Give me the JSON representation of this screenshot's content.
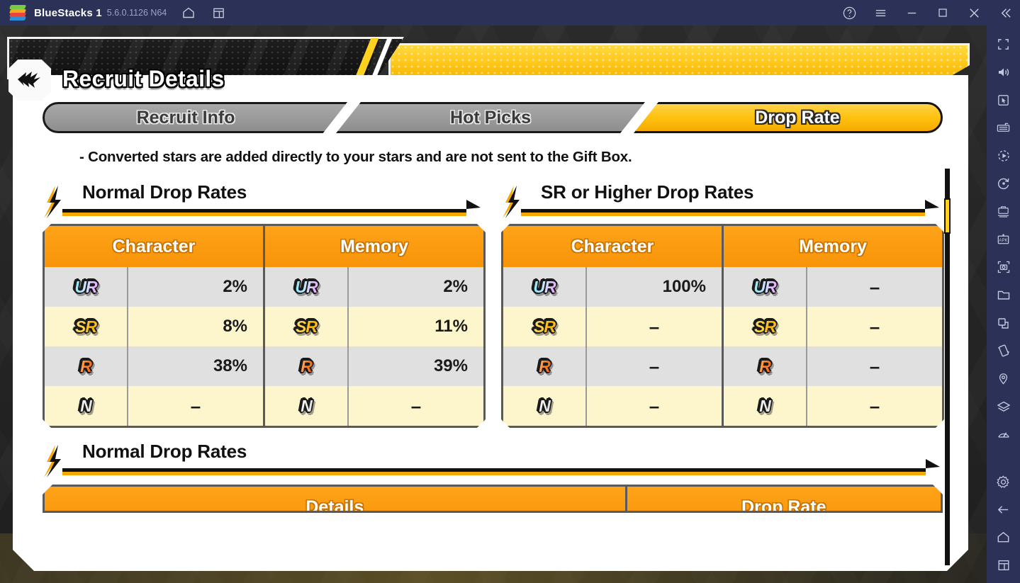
{
  "titlebar": {
    "app_name": "BlueStacks 1",
    "version": "5.6.0.1126 N64",
    "icons": [
      {
        "name": "home-icon",
        "glyph": "⌂"
      },
      {
        "name": "multi-instance-icon",
        "glyph": "❐"
      }
    ],
    "controls": [
      {
        "name": "help-icon",
        "glyph": "?"
      },
      {
        "name": "menu-icon",
        "glyph": "≡"
      },
      {
        "name": "minimize-icon",
        "glyph": "—"
      },
      {
        "name": "maximize-icon",
        "glyph": "□"
      },
      {
        "name": "close-icon",
        "glyph": "✕"
      },
      {
        "name": "collapse-sidebar-icon",
        "glyph": "«"
      }
    ]
  },
  "sidebar": {
    "items": [
      {
        "name": "fullscreen-icon"
      },
      {
        "name": "volume-icon"
      },
      {
        "name": "cursor-icon"
      },
      {
        "name": "keyboard-controls-icon"
      },
      {
        "name": "macro-recorder-icon"
      },
      {
        "name": "rotate-icon"
      },
      {
        "name": "multi-instance-manager-icon"
      },
      {
        "name": "install-apk-icon"
      },
      {
        "name": "screenshot-icon"
      },
      {
        "name": "media-folder-icon"
      },
      {
        "name": "copy-to-pc-icon"
      },
      {
        "name": "shake-icon"
      },
      {
        "name": "location-icon"
      },
      {
        "name": "layers-icon"
      },
      {
        "name": "performance-icon"
      },
      {
        "name": "settings-icon"
      },
      {
        "name": "back-icon"
      },
      {
        "name": "android-home-icon"
      },
      {
        "name": "recent-apps-icon"
      }
    ]
  },
  "game": {
    "header": {
      "title": "Recruit Details",
      "badge_icon": "lightning-arrow-icon"
    },
    "tabs": [
      {
        "label": "Recruit Info",
        "active": false
      },
      {
        "label": "Hot Picks",
        "active": false
      },
      {
        "label": "Drop Rate",
        "active": true
      }
    ],
    "note": "- Converted stars are added directly to your stars and are not sent to the Gift Box.",
    "sections": [
      {
        "title": "Normal Drop Rates",
        "columns": [
          "Character",
          "Memory"
        ],
        "rarities": [
          "UR",
          "SR",
          "R",
          "N"
        ],
        "character_rates": [
          "2%",
          "8%",
          "38%",
          "–"
        ],
        "memory_rates": [
          "2%",
          "11%",
          "39%",
          "–"
        ]
      },
      {
        "title": "SR or Higher Drop Rates",
        "columns": [
          "Character",
          "Memory"
        ],
        "rarities": [
          "UR",
          "SR",
          "R",
          "N"
        ],
        "character_rates": [
          "100%",
          "–",
          "–",
          "–"
        ],
        "memory_rates": [
          "–",
          "–",
          "–",
          "–"
        ]
      }
    ],
    "bottom_section": {
      "title": "Normal Drop Rates",
      "columns": [
        "Details",
        "Drop Rate"
      ]
    },
    "colors": {
      "accent_yellow": "#ffc20f",
      "header_orange": "#f89409",
      "row_gray": "#e0e0e0",
      "row_cream": "#fdf6cd",
      "panel_white": "#ffffff",
      "bluestacks_navy": "#2b3157"
    }
  }
}
